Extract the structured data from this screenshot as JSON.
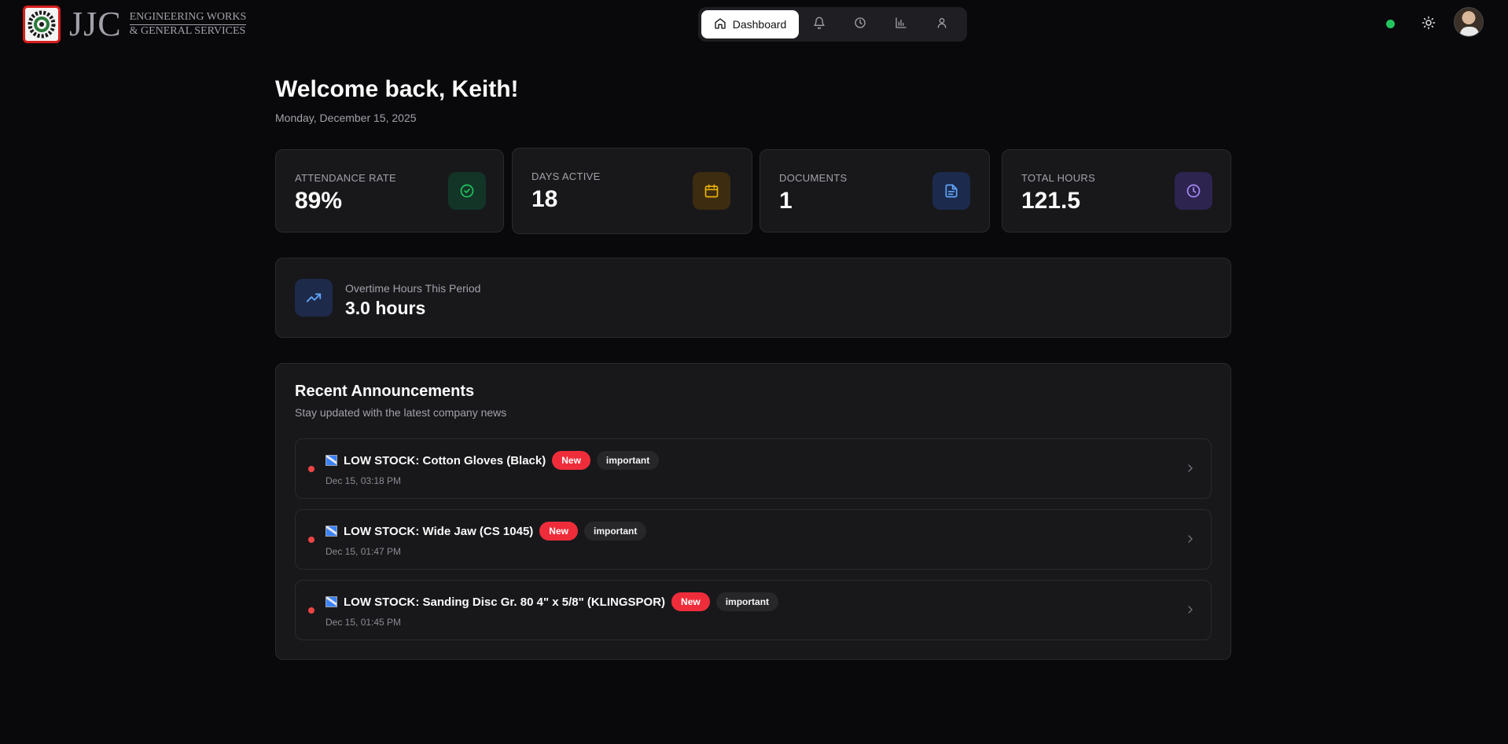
{
  "brand": {
    "logo_text": "JJC",
    "line1": "ENGINEERING WORKS",
    "line2": "& GENERAL SERVICES"
  },
  "nav": {
    "active_label": "Dashboard",
    "icons": [
      "home-icon",
      "bell-icon",
      "clock-icon",
      "bar-chart-icon",
      "user-icon"
    ]
  },
  "header": {
    "status_color": "#22c55e",
    "theme_icon": "sun-icon"
  },
  "welcome": {
    "title": "Welcome back, Keith!",
    "date": "Monday, December 15, 2025"
  },
  "stats": [
    {
      "label": "ATTENDANCE RATE",
      "value": "89%",
      "icon": "check-circle-icon",
      "color": "#22c55e"
    },
    {
      "label": "DAYS ACTIVE",
      "value": "18",
      "icon": "calendar-icon",
      "color": "#eab308"
    },
    {
      "label": "DOCUMENTS",
      "value": "1",
      "icon": "document-icon",
      "color": "#60a5fa"
    },
    {
      "label": "TOTAL HOURS",
      "value": "121.5",
      "icon": "clock-icon",
      "color": "#a78bfa"
    }
  ],
  "overtime": {
    "label": "Overtime Hours This Period",
    "value": "3.0 hours",
    "icon": "trending-up-icon"
  },
  "announcements": {
    "title": "Recent Announcements",
    "subtitle": "Stay updated with the latest company news",
    "items": [
      {
        "text": "LOW STOCK: Cotton Gloves (Black)",
        "badge_new": "New",
        "badge_tag": "important",
        "time": "Dec 15, 03:18 PM"
      },
      {
        "text": "LOW STOCK: Wide Jaw (CS 1045)",
        "badge_new": "New",
        "badge_tag": "important",
        "time": "Dec 15, 01:47 PM"
      },
      {
        "text": "LOW STOCK: Sanding Disc Gr. 80 4\" x 5/8\" (KLINGSPOR)",
        "badge_new": "New",
        "badge_tag": "important",
        "time": "Dec 15, 01:45 PM"
      }
    ]
  }
}
